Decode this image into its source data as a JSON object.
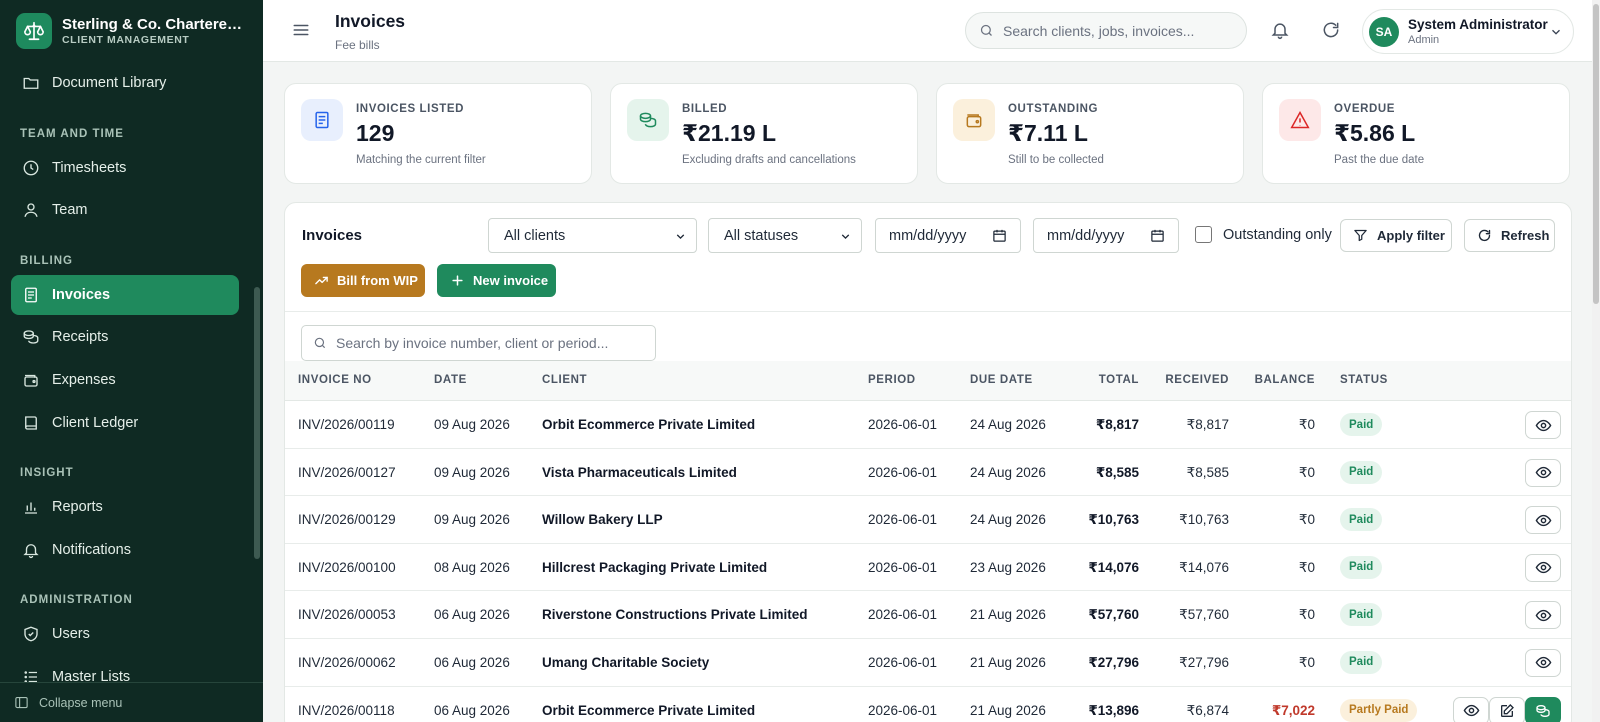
{
  "brand": {
    "name": "Sterling & Co. Chartered ...",
    "subtitle": "CLIENT MANAGEMENT"
  },
  "sidebar": {
    "items": [
      {
        "label": "Document Library",
        "icon": "folder-icon"
      },
      {
        "section": "TEAM AND TIME"
      },
      {
        "label": "Timesheets",
        "icon": "clock-icon"
      },
      {
        "label": "Team",
        "icon": "user-icon"
      },
      {
        "section": "BILLING"
      },
      {
        "label": "Invoices",
        "icon": "file-text-icon",
        "active": true
      },
      {
        "label": "Receipts",
        "icon": "coins-icon"
      },
      {
        "label": "Expenses",
        "icon": "wallet-icon"
      },
      {
        "label": "Client Ledger",
        "icon": "book-icon"
      },
      {
        "section": "INSIGHT"
      },
      {
        "label": "Reports",
        "icon": "bar-chart-icon"
      },
      {
        "label": "Notifications",
        "icon": "bell-icon"
      },
      {
        "section": "ADMINISTRATION"
      },
      {
        "label": "Users",
        "icon": "shield-icon"
      },
      {
        "label": "Master Lists",
        "icon": "list-icon"
      }
    ],
    "collapse_label": "Collapse menu"
  },
  "header": {
    "title": "Invoices",
    "subtitle": "Fee bills",
    "search_placeholder": "Search clients, jobs, invoices...",
    "user": {
      "initials": "SA",
      "name": "System Administrator",
      "role": "Admin"
    }
  },
  "stats": [
    {
      "label": "INVOICES LISTED",
      "value": "129",
      "note": "Matching the current filter",
      "color": "#2563eb"
    },
    {
      "label": "BILLED",
      "value": "₹21.19 L",
      "note": "Excluding drafts and cancellations",
      "color": "#1f8a5d"
    },
    {
      "label": "OUTSTANDING",
      "value": "₹7.11 L",
      "note": "Still to be collected",
      "color": "#b7791f"
    },
    {
      "label": "OVERDUE",
      "value": "₹5.86 L",
      "note": "Past the due date",
      "color": "#dc2626"
    }
  ],
  "panel": {
    "title": "Invoices",
    "client_filter": "All clients",
    "status_filter": "All statuses",
    "date_from": "mm/dd/yyyy",
    "date_to": "mm/dd/yyyy",
    "outstanding_only": "Outstanding only",
    "apply_label": "Apply filter",
    "refresh_label": "Refresh",
    "bill_wip_label": "Bill from WIP",
    "new_invoice_label": "New invoice",
    "table_search_placeholder": "Search by invoice number, client or period..."
  },
  "table": {
    "columns": [
      "INVOICE NO",
      "DATE",
      "CLIENT",
      "PERIOD",
      "DUE DATE",
      "TOTAL",
      "RECEIVED",
      "BALANCE",
      "STATUS"
    ],
    "rows": [
      {
        "invoice": "INV/2026/00119",
        "date": "09 Aug 2026",
        "client": "Orbit Ecommerce Private Limited",
        "period": "2026-06-01",
        "due": "24 Aug 2026",
        "total": "₹8,817",
        "received": "₹8,817",
        "balance": "₹0",
        "status": "Paid"
      },
      {
        "invoice": "INV/2026/00127",
        "date": "09 Aug 2026",
        "client": "Vista Pharmaceuticals Limited",
        "period": "2026-06-01",
        "due": "24 Aug 2026",
        "total": "₹8,585",
        "received": "₹8,585",
        "balance": "₹0",
        "status": "Paid"
      },
      {
        "invoice": "INV/2026/00129",
        "date": "09 Aug 2026",
        "client": "Willow Bakery LLP",
        "period": "2026-06-01",
        "due": "24 Aug 2026",
        "total": "₹10,763",
        "received": "₹10,763",
        "balance": "₹0",
        "status": "Paid"
      },
      {
        "invoice": "INV/2026/00100",
        "date": "08 Aug 2026",
        "client": "Hillcrest Packaging Private Limited",
        "period": "2026-06-01",
        "due": "23 Aug 2026",
        "total": "₹14,076",
        "received": "₹14,076",
        "balance": "₹0",
        "status": "Paid"
      },
      {
        "invoice": "INV/2026/00053",
        "date": "06 Aug 2026",
        "client": "Riverstone Constructions Private Limited",
        "period": "2026-06-01",
        "due": "21 Aug 2026",
        "total": "₹57,760",
        "received": "₹57,760",
        "balance": "₹0",
        "status": "Paid"
      },
      {
        "invoice": "INV/2026/00062",
        "date": "06 Aug 2026",
        "client": "Umang Charitable Society",
        "period": "2026-06-01",
        "due": "21 Aug 2026",
        "total": "₹27,796",
        "received": "₹27,796",
        "balance": "₹0",
        "status": "Paid"
      },
      {
        "invoice": "INV/2026/00118",
        "date": "06 Aug 2026",
        "client": "Orbit Ecommerce Private Limited",
        "period": "2026-06-01",
        "due": "21 Aug 2026",
        "total": "₹13,896",
        "received": "₹6,874",
        "balance": "₹7,022",
        "status": "Partly Paid"
      }
    ]
  },
  "colors": {
    "sidebar_bg": "#0f2a23",
    "accent": "#1f8a5d",
    "amber": "#b7791f",
    "danger": "#c0392b"
  }
}
